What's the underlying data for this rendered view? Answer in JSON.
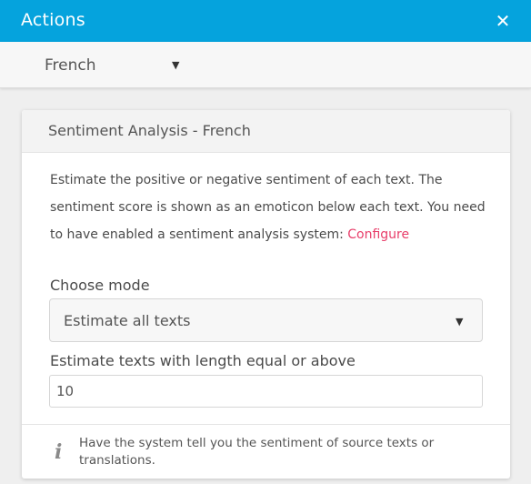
{
  "header": {
    "title": "Actions",
    "close_glyph": "✕",
    "close_icon": "close-icon"
  },
  "language_select": {
    "value": "French",
    "arrow": "▼"
  },
  "card": {
    "title": "Sentiment Analysis - French",
    "description": "Estimate the positive or negative sentiment of each text. The sentiment score is shown as an emoticon below each text. You need to have enabled a sentiment analysis system: ",
    "configure_link": "Configure",
    "mode_label": "Choose mode",
    "mode_value": "Estimate all texts",
    "mode_arrow": "▼",
    "length_label": "Estimate texts with length equal or above",
    "length_value": "10",
    "info_glyph": "i",
    "hint": "Have the system tell you the sentiment of source texts or translations."
  },
  "colors": {
    "header": "#05a3dd",
    "link": "#e83e6a"
  }
}
